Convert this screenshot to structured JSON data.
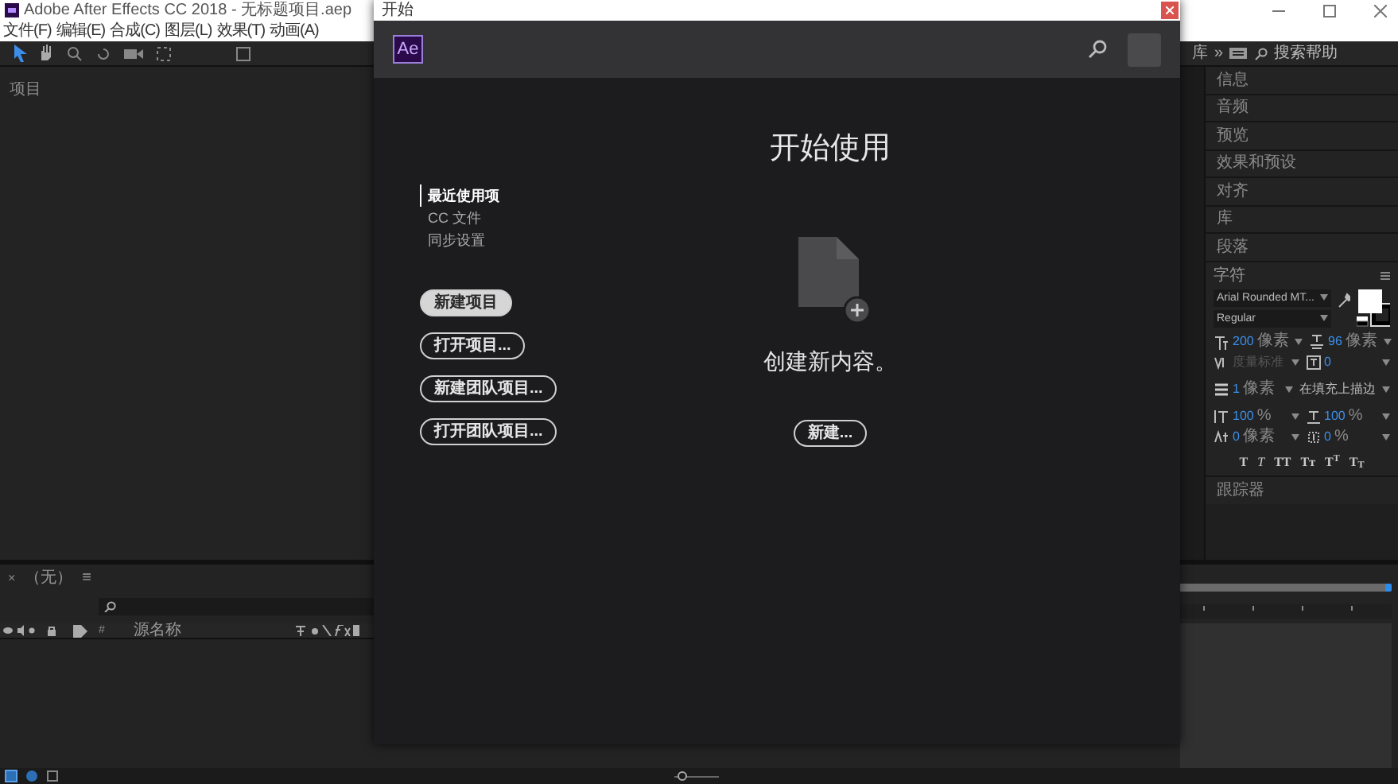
{
  "app": {
    "title": "Adobe After Effects CC 2018 - 无标题项目.aep",
    "menus": [
      "文件(F)",
      "编辑(E)",
      "合成(C)",
      "图层(L)",
      "效果(T)",
      "动画(A)"
    ]
  },
  "toolbar": {
    "workspace": "库",
    "overflow": "»",
    "help_search": {
      "placeholder": "搜索帮助"
    }
  },
  "project_panel": {
    "title": "项目"
  },
  "right_panels": [
    {
      "label": "信息"
    },
    {
      "label": "音频"
    },
    {
      "label": "预览"
    },
    {
      "label": "效果和预设"
    },
    {
      "label": "对齐"
    },
    {
      "label": "库"
    },
    {
      "label": "段落"
    }
  ],
  "character": {
    "title": "字符",
    "font": "Arial Rounded MT...",
    "style": "Regular",
    "metrics": [
      {
        "kind": "size",
        "value": "200",
        "unit": "像素",
        "disabled": false
      },
      {
        "kind": "leading",
        "value": "96",
        "unit": "像素",
        "disabled": false
      },
      {
        "kind": "kerning",
        "value": "度量标准",
        "disabled": true
      },
      {
        "kind": "tracking",
        "value": "0",
        "disabled": false
      },
      {
        "kind": "stroke",
        "value": "1",
        "unit": "像素",
        "disabled": false
      },
      {
        "kind": "stroke_mode",
        "value": "在填充上描边",
        "disabled": false
      },
      {
        "kind": "vscale",
        "value": "100",
        "unit": "%",
        "disabled": false
      },
      {
        "kind": "hscale",
        "value": "100",
        "unit": "%",
        "disabled": false
      },
      {
        "kind": "baseline",
        "value": "0",
        "unit": "像素",
        "disabled": false
      },
      {
        "kind": "tsume",
        "value": "0",
        "unit": "%",
        "disabled": false
      }
    ],
    "styles": [
      {
        "label": "T",
        "kind": "bold"
      },
      {
        "label": "T",
        "kind": "italic"
      },
      {
        "label": "TT",
        "kind": "caps"
      },
      {
        "label": "Tᴛ",
        "kind": "smallcaps"
      },
      {
        "label": "T$^{T}$",
        "kind": "super"
      },
      {
        "label": "T$_{T}$",
        "kind": "sub"
      }
    ]
  },
  "tracker": {
    "label": "跟踪器"
  },
  "timeline": {
    "close": "×",
    "comp": "（无）",
    "menu": "≡",
    "columns": [
      "#",
      "源名称"
    ]
  },
  "zoom_slider": {
    "level": 0.1
  },
  "dialog": {
    "title": "开始",
    "logo": "Ae",
    "heading": "开始使用",
    "nav": [
      {
        "label": "最近使用项",
        "selected": true
      },
      {
        "label": "CC 文件",
        "selected": false
      },
      {
        "label": "同步设置",
        "selected": false
      }
    ],
    "actions": [
      {
        "label": "新建项目",
        "highlighted": true
      },
      {
        "label": "打开项目...",
        "highlighted": false
      },
      {
        "label": "新建团队项目...",
        "highlighted": false
      },
      {
        "label": "打开团队项目...",
        "highlighted": false
      }
    ],
    "empty_state": {
      "message": "创建新内容。",
      "button": "新建..."
    }
  }
}
